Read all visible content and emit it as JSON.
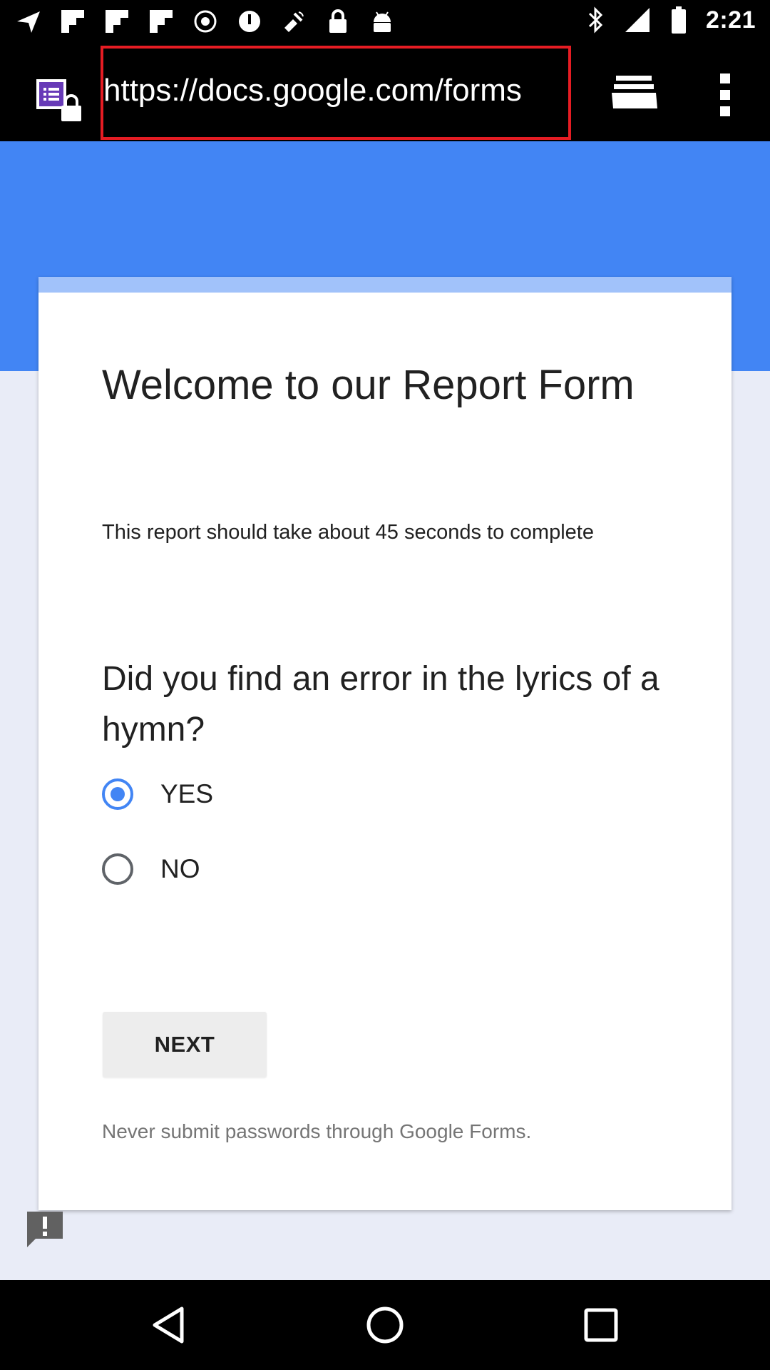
{
  "status_bar": {
    "time": "2:21",
    "icons": [
      "navigation-icon",
      "flipboard-icon",
      "flipboard-icon",
      "flipboard-icon",
      "record-icon",
      "vpn-key-icon",
      "fake-gps-icon",
      "lock-icon",
      "android-icon",
      "bluetooth-icon",
      "signal-icon",
      "battery-icon"
    ]
  },
  "browser": {
    "url": "https://docs.google.com/forms",
    "highlight_color": "#e51c23"
  },
  "form": {
    "title": "Welcome to our Report Form",
    "description": "This report should take about 45 seconds to complete",
    "question": "Did you find an error in the lyrics of a hymn?",
    "options": [
      {
        "label": "YES",
        "selected": true
      },
      {
        "label": "NO",
        "selected": false
      }
    ],
    "next_label": "NEXT",
    "footer_note": "Never submit passwords through Google Forms."
  },
  "colors": {
    "accent": "#4285f4",
    "accent_light": "#a1c2fa",
    "background": "#e9ecf7"
  }
}
